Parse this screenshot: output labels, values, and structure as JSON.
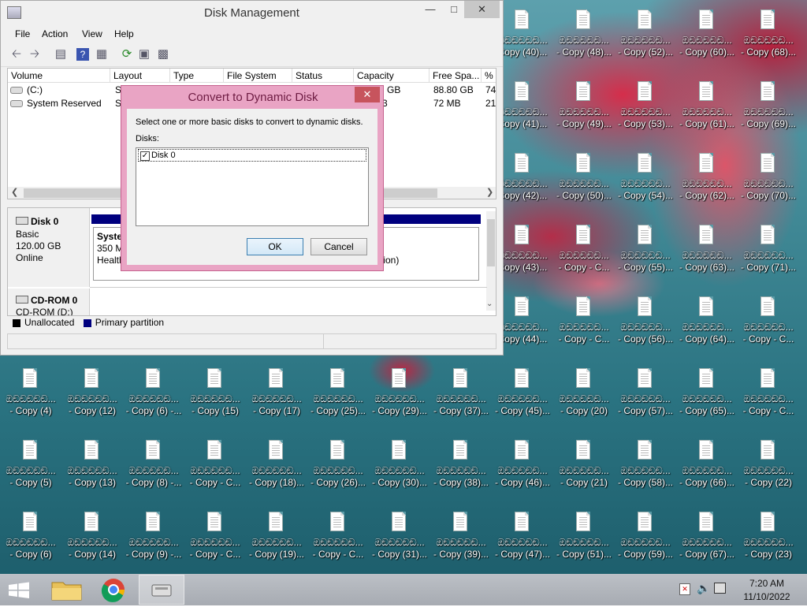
{
  "desktop": {
    "icon_label_line1": "ඔඞඞඞඞඞ...",
    "col_x": [
      8,
      86,
      164,
      242,
      320,
      398,
      476,
      554,
      632,
      710,
      788,
      866,
      944
    ],
    "icons_top": [
      {
        "col": 8,
        "row": 0,
        "suffix": "Copy (40)..."
      },
      {
        "col": 9,
        "row": 0,
        "suffix": "- Copy (48)..."
      },
      {
        "col": 10,
        "row": 0,
        "suffix": "- Copy (52)..."
      },
      {
        "col": 11,
        "row": 0,
        "suffix": "- Copy (60)..."
      },
      {
        "col": 12,
        "row": 0,
        "suffix": "- Copy (68)..."
      },
      {
        "col": 8,
        "row": 1,
        "suffix": "Copy (41)..."
      },
      {
        "col": 9,
        "row": 1,
        "suffix": "- Copy (49)..."
      },
      {
        "col": 10,
        "row": 1,
        "suffix": "- Copy (53)..."
      },
      {
        "col": 11,
        "row": 1,
        "suffix": "- Copy (61)..."
      },
      {
        "col": 12,
        "row": 1,
        "suffix": "- Copy (69)..."
      },
      {
        "col": 8,
        "row": 2,
        "suffix": "Copy (42)..."
      },
      {
        "col": 9,
        "row": 2,
        "suffix": "- Copy (50)..."
      },
      {
        "col": 10,
        "row": 2,
        "suffix": "- Copy (54)..."
      },
      {
        "col": 11,
        "row": 2,
        "suffix": "- Copy (62)..."
      },
      {
        "col": 12,
        "row": 2,
        "suffix": "- Copy (70)..."
      },
      {
        "col": 8,
        "row": 3,
        "suffix": "Copy (43)..."
      },
      {
        "col": 9,
        "row": 3,
        "suffix": "- Copy - C..."
      },
      {
        "col": 10,
        "row": 3,
        "suffix": "- Copy (55)..."
      },
      {
        "col": 11,
        "row": 3,
        "suffix": "- Copy (63)..."
      },
      {
        "col": 12,
        "row": 3,
        "suffix": "- Copy (71)..."
      },
      {
        "col": 8,
        "row": 4,
        "suffix": "Copy (44)..."
      },
      {
        "col": 9,
        "row": 4,
        "suffix": "- Copy - C..."
      },
      {
        "col": 10,
        "row": 4,
        "suffix": "- Copy (56)..."
      },
      {
        "col": 11,
        "row": 4,
        "suffix": "- Copy (64)..."
      },
      {
        "col": 12,
        "row": 4,
        "suffix": "- Copy - C..."
      },
      {
        "col": 0,
        "row": 5,
        "suffix": "- Copy (4)"
      },
      {
        "col": 1,
        "row": 5,
        "suffix": "- Copy (12)"
      },
      {
        "col": 2,
        "row": 5,
        "suffix": "- Copy (6) -..."
      },
      {
        "col": 3,
        "row": 5,
        "suffix": "- Copy (15)"
      },
      {
        "col": 4,
        "row": 5,
        "suffix": "- Copy (17)"
      },
      {
        "col": 5,
        "row": 5,
        "suffix": "- Copy (25)..."
      },
      {
        "col": 6,
        "row": 5,
        "suffix": "- Copy (29)..."
      },
      {
        "col": 7,
        "row": 5,
        "suffix": "- Copy (37)..."
      },
      {
        "col": 8,
        "row": 5,
        "suffix": "- Copy (45)..."
      },
      {
        "col": 9,
        "row": 5,
        "suffix": "- Copy (20)"
      },
      {
        "col": 10,
        "row": 5,
        "suffix": "- Copy (57)..."
      },
      {
        "col": 11,
        "row": 5,
        "suffix": "- Copy (65)..."
      },
      {
        "col": 12,
        "row": 5,
        "suffix": "- Copy - C..."
      },
      {
        "col": 0,
        "row": 6,
        "suffix": "- Copy (5)"
      },
      {
        "col": 1,
        "row": 6,
        "suffix": "- Copy (13)"
      },
      {
        "col": 2,
        "row": 6,
        "suffix": "- Copy (8) -..."
      },
      {
        "col": 3,
        "row": 6,
        "suffix": "- Copy - C..."
      },
      {
        "col": 4,
        "row": 6,
        "suffix": "- Copy (18)..."
      },
      {
        "col": 5,
        "row": 6,
        "suffix": "- Copy (26)..."
      },
      {
        "col": 6,
        "row": 6,
        "suffix": "- Copy (30)..."
      },
      {
        "col": 7,
        "row": 6,
        "suffix": "- Copy (38)..."
      },
      {
        "col": 8,
        "row": 6,
        "suffix": "- Copy (46)..."
      },
      {
        "col": 9,
        "row": 6,
        "suffix": "- Copy (21)"
      },
      {
        "col": 10,
        "row": 6,
        "suffix": "- Copy (58)..."
      },
      {
        "col": 11,
        "row": 6,
        "suffix": "- Copy (66)..."
      },
      {
        "col": 12,
        "row": 6,
        "suffix": "- Copy (22)"
      },
      {
        "col": 0,
        "row": 7,
        "suffix": "- Copy (6)"
      },
      {
        "col": 1,
        "row": 7,
        "suffix": "- Copy (14)"
      },
      {
        "col": 2,
        "row": 7,
        "suffix": "- Copy (9) -..."
      },
      {
        "col": 3,
        "row": 7,
        "suffix": "- Copy - C..."
      },
      {
        "col": 4,
        "row": 7,
        "suffix": "- Copy (19)..."
      },
      {
        "col": 5,
        "row": 7,
        "suffix": "- Copy - C..."
      },
      {
        "col": 6,
        "row": 7,
        "suffix": "- Copy (31)..."
      },
      {
        "col": 7,
        "row": 7,
        "suffix": "- Copy (39)..."
      },
      {
        "col": 8,
        "row": 7,
        "suffix": "- Copy (47)..."
      },
      {
        "col": 9,
        "row": 7,
        "suffix": "- Copy (51)..."
      },
      {
        "col": 10,
        "row": 7,
        "suffix": "- Copy (59)..."
      },
      {
        "col": 11,
        "row": 7,
        "suffix": "- Copy (67)..."
      },
      {
        "col": 12,
        "row": 7,
        "suffix": "- Copy (23)"
      }
    ]
  },
  "window": {
    "title": "Disk Management",
    "menu": [
      "File",
      "Action",
      "View",
      "Help"
    ],
    "columns": [
      "Volume",
      "Layout",
      "Type",
      "File System",
      "Status",
      "Capacity",
      "Free Spa...",
      "% F"
    ],
    "rows": [
      {
        "volume": "(C:)",
        "layout": "Si",
        "capacity": "GB",
        "free": "88.80 GB",
        "pct": "74"
      },
      {
        "volume": "System Reserved",
        "layout": "Si",
        "capacity": "3",
        "free": "72 MB",
        "pct": "21"
      }
    ],
    "disk0": {
      "name": "Disk 0",
      "type": "Basic",
      "size": "120.00 GB",
      "status": "Online",
      "part_name": "Syste",
      "part_size": "350 M",
      "part_health": "Health",
      "part2_suffix": "tion)"
    },
    "cdrom": {
      "name": "CD-ROM 0",
      "sub": "CD-ROM (D:)"
    },
    "legend": {
      "unallocated": "Unallocated",
      "primary": "Primary partition",
      "unallocated_color": "#000000",
      "primary_color": "#00007f"
    }
  },
  "dialog": {
    "title": "Convert to Dynamic Disk",
    "instruction": "Select one or more basic disks to convert to dynamic disks.",
    "disks_label": "Disks:",
    "disk_item": "Disk 0",
    "disk_checked": true,
    "ok": "OK",
    "cancel": "Cancel"
  },
  "taskbar": {
    "time": "7:20 AM",
    "date": "11/10/2022"
  }
}
